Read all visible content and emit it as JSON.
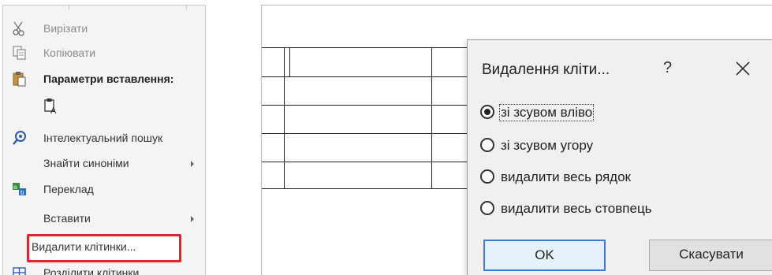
{
  "context_menu": {
    "items": [
      {
        "label": "Вирізати",
        "icon": "scissors-icon",
        "state": "disabled"
      },
      {
        "label": "Копіювати",
        "icon": "copy-icon",
        "state": "disabled"
      },
      {
        "label": "Параметри вставлення:",
        "icon": "paste-icon",
        "state": "header"
      },
      {
        "label": "",
        "icon": "paste-keep-text-icon",
        "state": "normal"
      },
      {
        "label": "Інтелектуальний пошук",
        "icon": "smart-lookup-icon",
        "state": "normal"
      },
      {
        "label": "Знайти синоніми",
        "icon": "",
        "state": "submenu"
      },
      {
        "label": "Переклад",
        "icon": "translate-icon",
        "state": "normal"
      },
      {
        "label": "Вставити",
        "icon": "",
        "state": "submenu"
      },
      {
        "label": "Видалити клітинки...",
        "icon": "",
        "state": "highlighted"
      },
      {
        "label": "Розділити клітинки...",
        "icon": "split-cells-icon",
        "state": "normal"
      }
    ],
    "highlight_color": "#e3242b"
  },
  "dialog": {
    "title": "Видалення кліти...",
    "help_label": "?",
    "options": [
      {
        "label": "зі зсувом вліво",
        "checked": true
      },
      {
        "label": "зі зсувом угору",
        "checked": false
      },
      {
        "label": "видалити весь рядок",
        "checked": false
      },
      {
        "label": "видалити весь стовпець",
        "checked": false
      }
    ],
    "ok_label": "OK",
    "cancel_label": "Скасувати"
  }
}
